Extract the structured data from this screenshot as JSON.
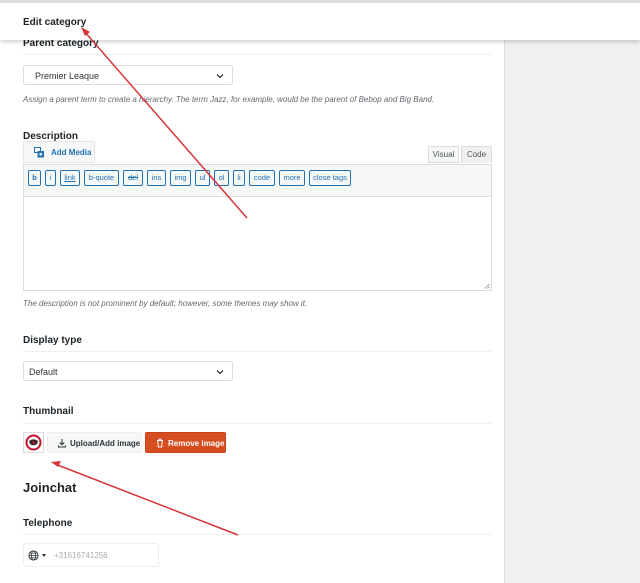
{
  "header": {
    "title": "Edit category"
  },
  "parent_category": {
    "label": "Parent category",
    "selected": "Premier Leaque",
    "help": "Assign a parent term to create a hierarchy. The term Jazz, for example, would be the parent of Bebop and Big Band."
  },
  "description": {
    "label": "Description",
    "add_media": "Add Media",
    "tab_visual": "Visual",
    "tab_code": "Code",
    "quicktags": [
      "b",
      "i",
      "link",
      "b-quote",
      "del",
      "ins",
      "img",
      "ul",
      "ol",
      "li",
      "code",
      "more",
      "close tags"
    ],
    "value": "",
    "help": "The description is not prominent by default; however, some themes may show it."
  },
  "display_type": {
    "label": "Display type",
    "selected": "Default"
  },
  "thumbnail": {
    "label": "Thumbnail",
    "upload_label": "Upload/Add image",
    "remove_label": "Remove image"
  },
  "joinchat": {
    "heading": "Joinchat",
    "telephone_label": "Telephone",
    "telephone_placeholder": "+31616741256"
  },
  "colors": {
    "accent": "#2271b1",
    "remove_button": "#d54e21",
    "annotation_arrow": "#d63638"
  }
}
